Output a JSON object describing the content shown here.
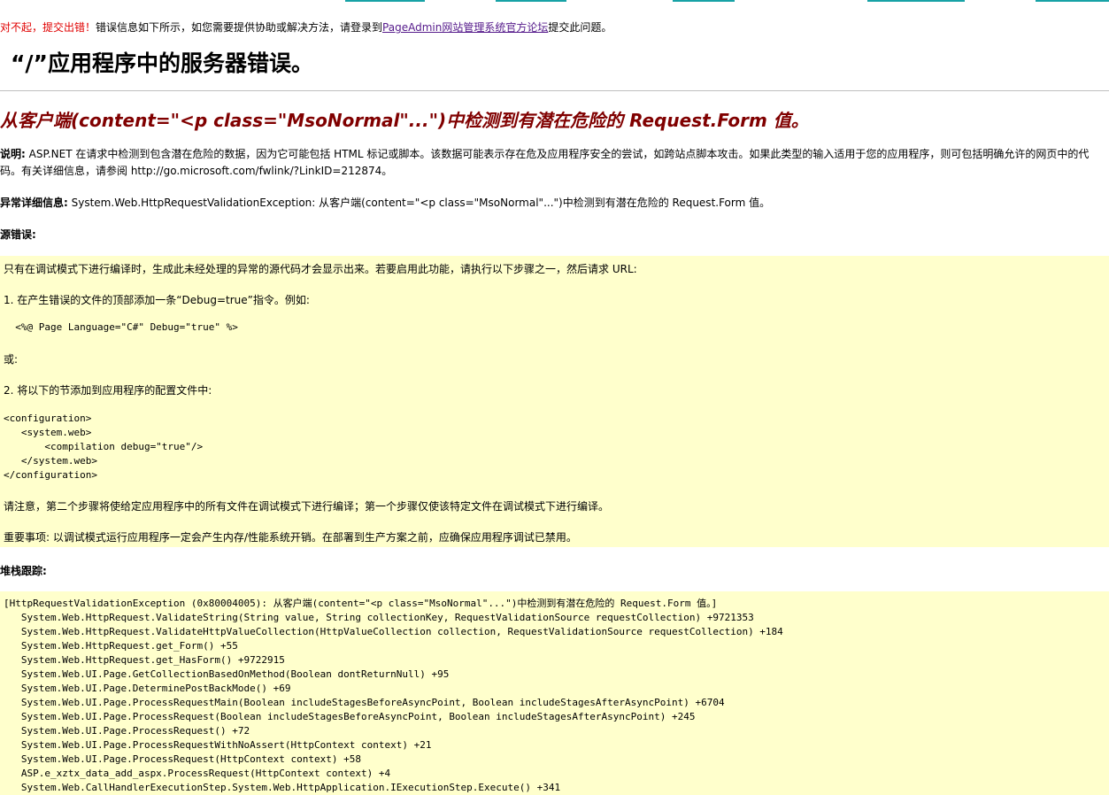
{
  "notice": {
    "apology": "对不起，提交出错！",
    "message": "错误信息如下所示，如您需要提供协助或解决方法，请登录到",
    "link_text": "PageAdmin网站管理系统官方论坛",
    "suffix": "提交此问题。"
  },
  "page_title": "“/”应用程序中的服务器错误。",
  "error_heading": "从客户端(content=\"<p class=\"MsoNormal\"...\")中检测到有潜在危险的 Request.Form 值。",
  "description": {
    "label": "说明:",
    "text": " ASP.NET 在请求中检测到包含潜在危险的数据，因为它可能包括 HTML 标记或脚本。该数据可能表示存在危及应用程序安全的尝试，如跨站点脚本攻击。如果此类型的输入适用于您的应用程序，则可包括明确允许的网页中的代码。有关详细信息，请参阅 http://go.microsoft.com/fwlink/?LinkID=212874。"
  },
  "exception_details": {
    "label": "异常详细信息:",
    "text": " System.Web.HttpRequestValidationException: 从客户端(content=\"<p class=\"MsoNormal\"...\")中检测到有潜在危险的 Request.Form 值。"
  },
  "source_error": {
    "label": "源错误:",
    "line1": "只有在调试模式下进行编译时，生成此未经处理的异常的源代码才会显示出来。若要启用此功能，请执行以下步骤之一，然后请求 URL:",
    "line2": "1. 在产生错误的文件的顶部添加一条“Debug=true”指令。例如:",
    "line3": "  <%@ Page Language=\"C#\" Debug=\"true\" %>",
    "line4": "或:",
    "line5": "2. 将以下的节添加到应用程序的配置文件中:",
    "config": "<configuration>\n   <system.web>\n       <compilation debug=\"true\"/>\n   </system.web>\n</configuration>",
    "line6": "请注意，第二个步骤将使给定应用程序中的所有文件在调试模式下进行编译；第一个步骤仅使该特定文件在调试模式下进行编译。",
    "line7": "重要事项: 以调试模式运行应用程序一定会产生内存/性能系统开销。在部署到生产方案之前，应确保应用程序调试已禁用。"
  },
  "stack_trace": {
    "label": "堆栈跟踪:",
    "lines": [
      "[HttpRequestValidationException (0x80004005): 从客户端(content=\"<p class=\"MsoNormal\"...\")中检测到有潜在危险的 Request.Form 值。]",
      "   System.Web.HttpRequest.ValidateString(String value, String collectionKey, RequestValidationSource requestCollection) +9721353",
      "   System.Web.HttpRequest.ValidateHttpValueCollection(HttpValueCollection collection, RequestValidationSource requestCollection) +184",
      "   System.Web.HttpRequest.get_Form() +55",
      "   System.Web.HttpRequest.get_HasForm() +9722915",
      "   System.Web.UI.Page.GetCollectionBasedOnMethod(Boolean dontReturnNull) +95",
      "   System.Web.UI.Page.DeterminePostBackMode() +69",
      "   System.Web.UI.Page.ProcessRequestMain(Boolean includeStagesBeforeAsyncPoint, Boolean includeStagesAfterAsyncPoint) +6704",
      "   System.Web.UI.Page.ProcessRequest(Boolean includeStagesBeforeAsyncPoint, Boolean includeStagesAfterAsyncPoint) +245",
      "   System.Web.UI.Page.ProcessRequest() +72",
      "   System.Web.UI.Page.ProcessRequestWithNoAssert(HttpContext context) +21",
      "   System.Web.UI.Page.ProcessRequest(HttpContext context) +58",
      "   ASP.e_xztx_data_add_aspx.ProcessRequest(HttpContext context) +4",
      "   System.Web.CallHandlerExecutionStep.System.Web.HttpApplication.IExecutionStep.Execute() +341"
    ]
  }
}
